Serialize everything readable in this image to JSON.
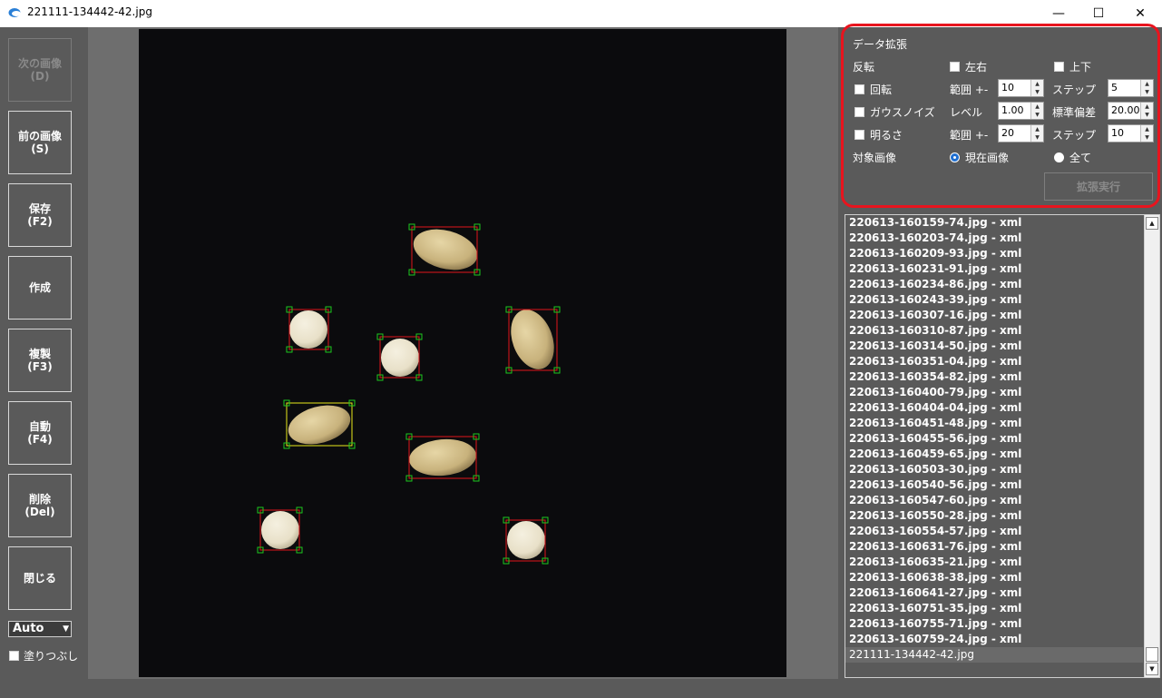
{
  "window": {
    "title": "221111-134442-42.jpg",
    "minimize_glyph": "—",
    "maximize_glyph": "☐",
    "close_glyph": "✕"
  },
  "toolbar": {
    "next_line1": "次の画像",
    "next_line2": "(D)",
    "prev_line1": "前の画像",
    "prev_line2": "(S)",
    "save_line1": "保存",
    "save_line2": "(F2)",
    "create_label": "作成",
    "copy_line1": "複製",
    "copy_line2": "(F3)",
    "auto_line1": "自動",
    "auto_line2": "(F4)",
    "delete_line1": "削除",
    "delete_line2": "(Del)",
    "close_label": "閉じる",
    "mode_value": "Auto",
    "fill_label": "塗りつぶし"
  },
  "augmentation": {
    "title": "データ拡張",
    "flip_label": "反転",
    "flip_lr_label": "左右",
    "flip_ud_label": "上下",
    "rotate_label": "回転",
    "rotate_range_label": "範囲 +-",
    "rotate_range_value": "10",
    "rotate_step_label": "ステップ",
    "rotate_step_value": "5",
    "noise_label": "ガウスノイズ",
    "noise_level_label": "レベル",
    "noise_level_value": "1.00",
    "noise_std_label": "標準偏差",
    "noise_std_value": "20.00",
    "bright_label": "明るさ",
    "bright_range_label": "範囲 +-",
    "bright_range_value": "20",
    "bright_step_label": "ステップ",
    "bright_step_value": "10",
    "target_label": "対象画像",
    "target_current_label": "現在画像",
    "target_all_label": "全て",
    "execute_label": "拡張実行"
  },
  "file_list": [
    "220613-160159-74.jpg - xml",
    "220613-160203-74.jpg - xml",
    "220613-160209-93.jpg - xml",
    "220613-160231-91.jpg - xml",
    "220613-160234-86.jpg - xml",
    "220613-160243-39.jpg - xml",
    "220613-160307-16.jpg - xml",
    "220613-160310-87.jpg - xml",
    "220613-160314-50.jpg - xml",
    "220613-160351-04.jpg - xml",
    "220613-160354-82.jpg - xml",
    "220613-160400-79.jpg - xml",
    "220613-160404-04.jpg - xml",
    "220613-160451-48.jpg - xml",
    "220613-160455-56.jpg - xml",
    "220613-160459-65.jpg - xml",
    "220613-160503-30.jpg - xml",
    "220613-160540-56.jpg - xml",
    "220613-160547-60.jpg - xml",
    "220613-160550-28.jpg - xml",
    "220613-160554-57.jpg - xml",
    "220613-160631-76.jpg - xml",
    "220613-160635-21.jpg - xml",
    "220613-160638-38.jpg - xml",
    "220613-160641-27.jpg - xml",
    "220613-160751-35.jpg - xml",
    "220613-160755-71.jpg - xml",
    "220613-160759-24.jpg - xml",
    "221111-134442-42.jpg"
  ],
  "colors": {
    "highlight_border": "#e8141e",
    "bbox_red": "#e0141a",
    "bbox_selected": "#e8e81a",
    "handle_green": "#1ec81e",
    "canvas_background": "#0b0b0d",
    "panel_background": "#5a5a5a"
  },
  "icons": {
    "app": "app-logo-icon",
    "combo_arrow": "chevron-down-icon",
    "scroll_up": "scroll-up-arrow-icon",
    "scroll_down": "scroll-down-arrow-icon"
  }
}
